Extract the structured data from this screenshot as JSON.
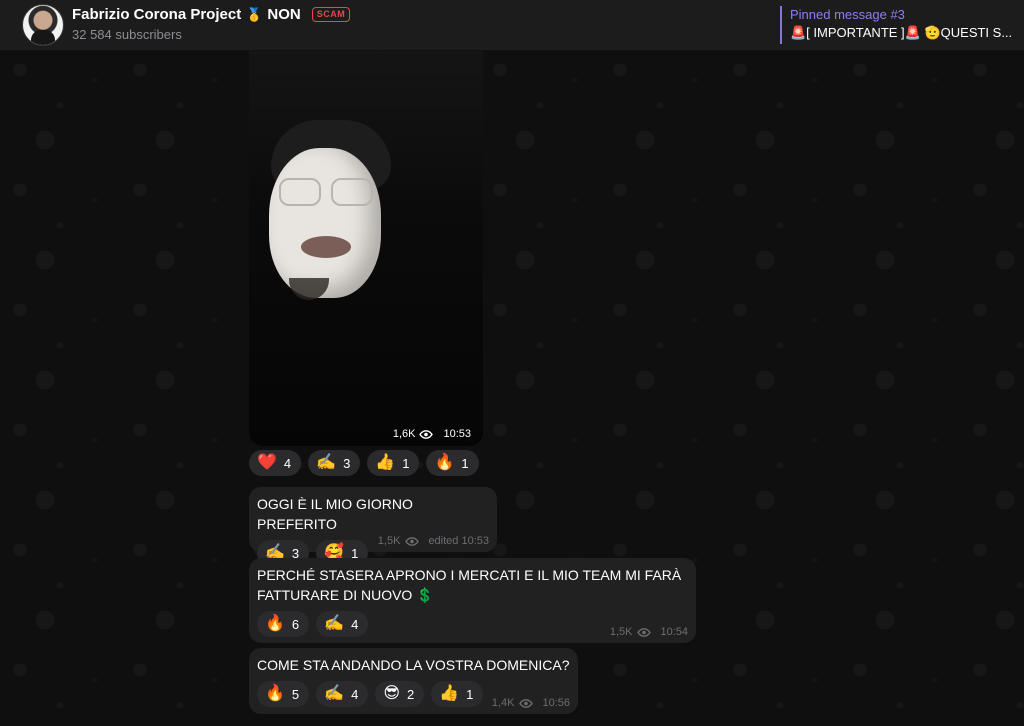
{
  "header": {
    "channel_name": "Fabrizio Corona Project",
    "medal": "🥇",
    "name_suffix": "NON",
    "badge": "SCAM",
    "subscribers": "32 584 subscribers",
    "pinned_title": "Pinned message #3",
    "pinned_text": "🚨[ IMPORTANTE ]🚨 🫡QUESTI S..."
  },
  "media_message": {
    "views": "1,6K",
    "time": "10:53",
    "reactions": [
      {
        "emoji": "❤️",
        "count": "4"
      },
      {
        "emoji": "✍️",
        "count": "3"
      },
      {
        "emoji": "👍",
        "count": "1"
      },
      {
        "emoji": "🔥",
        "count": "1"
      }
    ]
  },
  "messages": [
    {
      "text": "OGGI È IL MIO GIORNO PREFERITO",
      "views": "1,5K",
      "time": "edited 10:53",
      "reactions": [
        {
          "emoji": "✍️",
          "count": "3"
        },
        {
          "emoji": "🥰",
          "count": "1"
        }
      ]
    },
    {
      "text": "PERCHÉ STASERA APRONO I MERCATI E IL MIO TEAM MI FARÀ FATTURARE DI NUOVO 💲",
      "views": "1,5K",
      "time": "10:54",
      "reactions": [
        {
          "emoji": "🔥",
          "count": "6"
        },
        {
          "emoji": "✍️",
          "count": "4"
        }
      ]
    },
    {
      "text": "COME STA ANDANDO LA VOSTRA DOMENICA?",
      "views": "1,4K",
      "time": "10:56",
      "reactions": [
        {
          "emoji": "🔥",
          "count": "5"
        },
        {
          "emoji": "✍️",
          "count": "4"
        },
        {
          "emoji": "😎",
          "count": "2"
        },
        {
          "emoji": "👍",
          "count": "1"
        }
      ]
    }
  ],
  "colors": {
    "accent": "#8774e1",
    "scam": "#e5484d",
    "bubble": "#212121",
    "reaction_bg": "#2b2b2d"
  }
}
